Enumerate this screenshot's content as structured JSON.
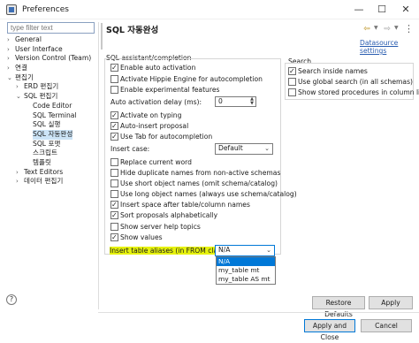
{
  "window": {
    "title": "Preferences",
    "controls": [
      "—",
      "☐",
      "✕"
    ]
  },
  "filter": {
    "placeholder": "type filter text"
  },
  "tree": [
    {
      "label": "General",
      "level": 0,
      "arrow": "›"
    },
    {
      "label": "User Interface",
      "level": 0,
      "arrow": "›"
    },
    {
      "label": "Version Control (Team)",
      "level": 0,
      "arrow": "›"
    },
    {
      "label": "연결",
      "level": 0,
      "arrow": "›"
    },
    {
      "label": "편집기",
      "level": 0,
      "arrow": "⌄"
    },
    {
      "label": "ERD 편집기",
      "level": 1,
      "arrow": "›"
    },
    {
      "label": "SQL 편집기",
      "level": 1,
      "arrow": "⌄"
    },
    {
      "label": "Code Editor",
      "level": 2,
      "arrow": ""
    },
    {
      "label": "SQL Terminal",
      "level": 2,
      "arrow": ""
    },
    {
      "label": "SQL 실행",
      "level": 2,
      "arrow": ""
    },
    {
      "label": "SQL 자동완성",
      "level": 2,
      "arrow": "",
      "selected": true
    },
    {
      "label": "SQL 포맷",
      "level": 2,
      "arrow": ""
    },
    {
      "label": "스크립트",
      "level": 2,
      "arrow": ""
    },
    {
      "label": "템플릿",
      "level": 2,
      "arrow": ""
    },
    {
      "label": "Text Editors",
      "level": 1,
      "arrow": "›"
    },
    {
      "label": "데이터 편집기",
      "level": 1,
      "arrow": "›"
    }
  ],
  "help_icon": "?",
  "page": {
    "title": "SQL 자동완성",
    "datasource_link": "Datasource settings"
  },
  "nav": {
    "back": "⇦",
    "forward": "⇨",
    "caret": "▼",
    "more": "⋮"
  },
  "assist": {
    "group_label": "SQL assistant/completion",
    "checks": [
      {
        "label": "Enable auto activation",
        "checked": true
      },
      {
        "label": "Activate Hippie Engine for autocompletion",
        "checked": false
      },
      {
        "label": "Enable experimental features",
        "checked": false
      }
    ],
    "delay_label": "Auto activation delay (ms):",
    "delay_value": "0",
    "checks2": [
      {
        "label": "Activate on typing",
        "checked": true
      },
      {
        "label": "Auto-insert proposal",
        "checked": true
      },
      {
        "label": "Use Tab for autocompletion",
        "checked": true
      }
    ],
    "insert_case_label": "Insert case:",
    "insert_case_value": "Default",
    "checks3": [
      {
        "label": "Replace current word",
        "checked": false
      },
      {
        "label": "Hide duplicate names from non-active schemas",
        "checked": false
      },
      {
        "label": "Use short object names (omit schema/catalog)",
        "checked": false
      },
      {
        "label": "Use long object names (always use schema/catalog)",
        "checked": false
      },
      {
        "label": "Insert space after table/column names",
        "checked": true
      },
      {
        "label": "Sort proposals alphabetically",
        "checked": true
      },
      {
        "label": "Show server help topics",
        "checked": false
      },
      {
        "label": "Show values",
        "checked": true
      }
    ],
    "alias_label": "Insert table aliases (in FROM clause):",
    "alias_value": "N/A",
    "alias_options": [
      "N/A",
      "my_table mt",
      "my_table AS mt"
    ]
  },
  "search": {
    "group_label": "Search",
    "checks": [
      {
        "label": "Search inside names",
        "checked": true
      },
      {
        "label": "Use global search (in all schemas)",
        "checked": false
      },
      {
        "label": "Show stored procedures in column list",
        "checked": false
      }
    ]
  },
  "buttons": {
    "restore": "Restore Defaults",
    "apply": "Apply",
    "apply_close": "Apply and Close",
    "cancel": "Cancel"
  },
  "colors": {
    "selection": "#0078d7",
    "highlight": "#e6f20e",
    "link": "#2a5db0"
  }
}
